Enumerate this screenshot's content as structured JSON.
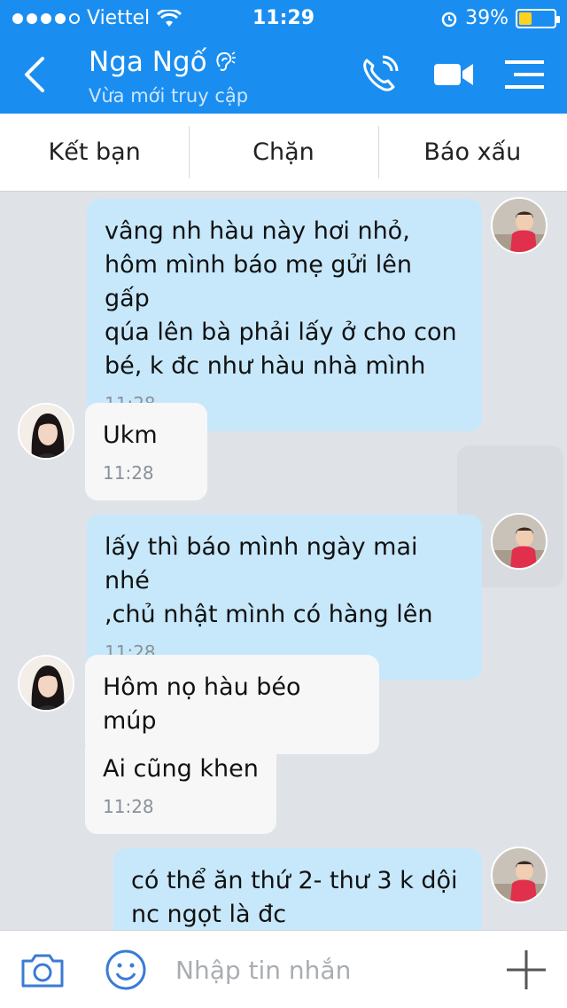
{
  "status_bar": {
    "carrier": "Viettel",
    "time": "11:29",
    "battery_percent": "39%",
    "battery_level": 0.39,
    "signal_dots_filled": 4
  },
  "header": {
    "back_icon": "chevron-left-icon",
    "title": "Nga Ngố",
    "subtitle": "Vừa mới truy cập",
    "icons": [
      "ear-icon",
      "phone-icon",
      "video-icon",
      "menu-icon"
    ]
  },
  "actions": [
    {
      "label": "Kết bạn"
    },
    {
      "label": "Chặn"
    },
    {
      "label": "Báo xấu"
    }
  ],
  "messages": [
    {
      "from": "me",
      "lines": [
        "vâng nh hàu này hơi nhỏ,",
        "hôm mình báo mẹ gửi lên gấp",
        "qúa lên bà phải lấy ở cho con",
        "bé, k đc như hàu nhà mình"
      ],
      "time": "11:28"
    },
    {
      "from": "them",
      "lines": [
        "Ukm"
      ],
      "time": "11:28"
    },
    {
      "from": "me",
      "lines": [
        "lấy thì báo mình ngày mai nhé",
        ",chủ nhật mình có hàng lên"
      ],
      "time": "11:28"
    },
    {
      "from": "them",
      "lines": [
        "Hôm nọ hàu béo múp"
      ],
      "time": ""
    },
    {
      "from": "them",
      "lines": [
        "Ai cũng khen"
      ],
      "time": "11:28"
    },
    {
      "from": "me",
      "lines": [
        "có thể ăn thứ 2- thư 3 k dội",
        "nc ngọt là đc"
      ],
      "time": ""
    }
  ],
  "input": {
    "placeholder": "Nhập tin nhắn"
  },
  "colors": {
    "header_bg": "#1a8ef0",
    "bubble_me": "#c7e8fb",
    "bubble_them": "#f7f7f7",
    "chat_bg": "#dfe3e8"
  }
}
